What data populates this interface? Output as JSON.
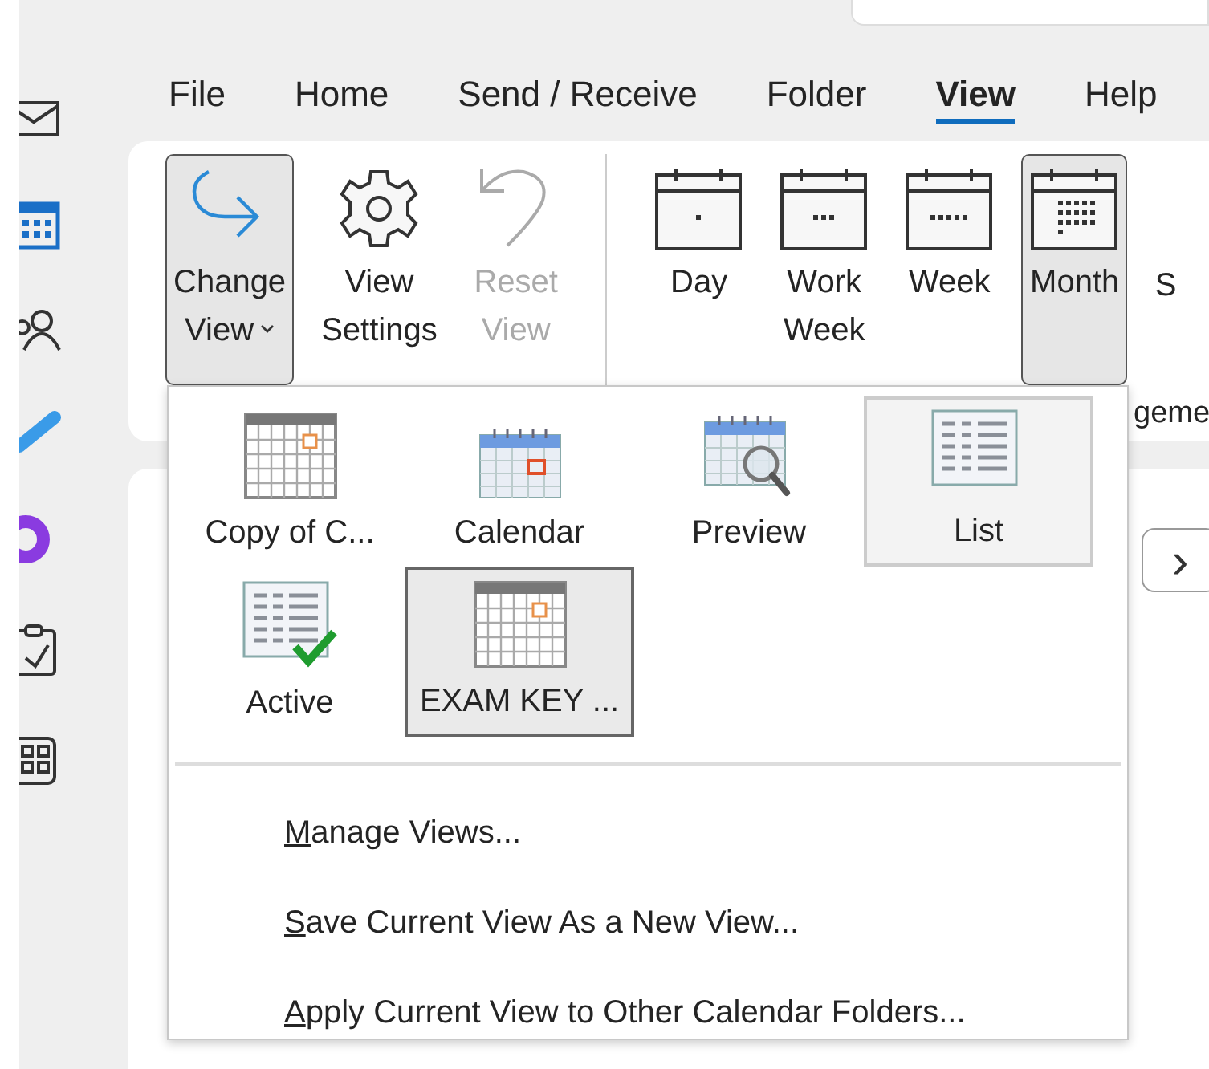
{
  "nav_rail": {
    "icons": [
      {
        "kind": "mail"
      },
      {
        "kind": "calendar"
      },
      {
        "kind": "people"
      },
      {
        "kind": "todo"
      },
      {
        "kind": "ring"
      },
      {
        "kind": "clipboard"
      },
      {
        "kind": "apps"
      }
    ]
  },
  "menu_tabs": [
    {
      "label": "File",
      "selected": false
    },
    {
      "label": "Home",
      "selected": false
    },
    {
      "label": "Send / Receive",
      "selected": false
    },
    {
      "label": "Folder",
      "selected": false
    },
    {
      "label": "View",
      "selected": true
    },
    {
      "label": "Help",
      "selected": false
    }
  ],
  "ribbon": {
    "buttons": [
      {
        "kind": "change-view",
        "lines": [
          "Change",
          "View"
        ],
        "pressed": true,
        "disabled": false,
        "dropdown": true
      },
      {
        "kind": "settings",
        "lines": [
          "View",
          "Settings"
        ],
        "pressed": false,
        "disabled": false,
        "dropdown": false
      },
      {
        "kind": "reset",
        "lines": [
          "Reset",
          "View"
        ],
        "pressed": false,
        "disabled": true,
        "dropdown": false
      },
      {
        "kind": "separator"
      },
      {
        "kind": "day",
        "lines": [
          "Day"
        ],
        "pressed": false,
        "disabled": false,
        "dropdown": false
      },
      {
        "kind": "work-week",
        "lines": [
          "Work",
          "Week"
        ],
        "pressed": false,
        "disabled": false,
        "dropdown": false
      },
      {
        "kind": "week",
        "lines": [
          "Week"
        ],
        "pressed": false,
        "disabled": false,
        "dropdown": false
      },
      {
        "kind": "month",
        "lines": [
          "Month"
        ],
        "pressed": true,
        "disabled": false,
        "dropdown": false
      },
      {
        "kind": "partial",
        "lines": [
          "S"
        ],
        "pressed": false,
        "disabled": false,
        "dropdown": false
      }
    ],
    "group_label": "geme"
  },
  "change_view_menu": {
    "gallery": [
      {
        "label": "Copy of C...",
        "kind": "grid",
        "selected": false,
        "hovered": false
      },
      {
        "label": "Calendar",
        "kind": "blue-calendar",
        "selected": false,
        "hovered": false
      },
      {
        "label": "Preview",
        "kind": "preview",
        "selected": false,
        "hovered": false
      },
      {
        "label": "List",
        "kind": "list",
        "selected": false,
        "hovered": true
      },
      {
        "label": "Active",
        "kind": "list-check",
        "selected": false,
        "hovered": false
      },
      {
        "label": "EXAM KEY ...",
        "kind": "grid",
        "selected": true,
        "hovered": false
      }
    ],
    "commands": [
      "Manage Views...",
      "Save Current View As a New View...",
      "Apply Current View to Other Calendar Folders..."
    ]
  },
  "content": {
    "next_button": "›"
  }
}
